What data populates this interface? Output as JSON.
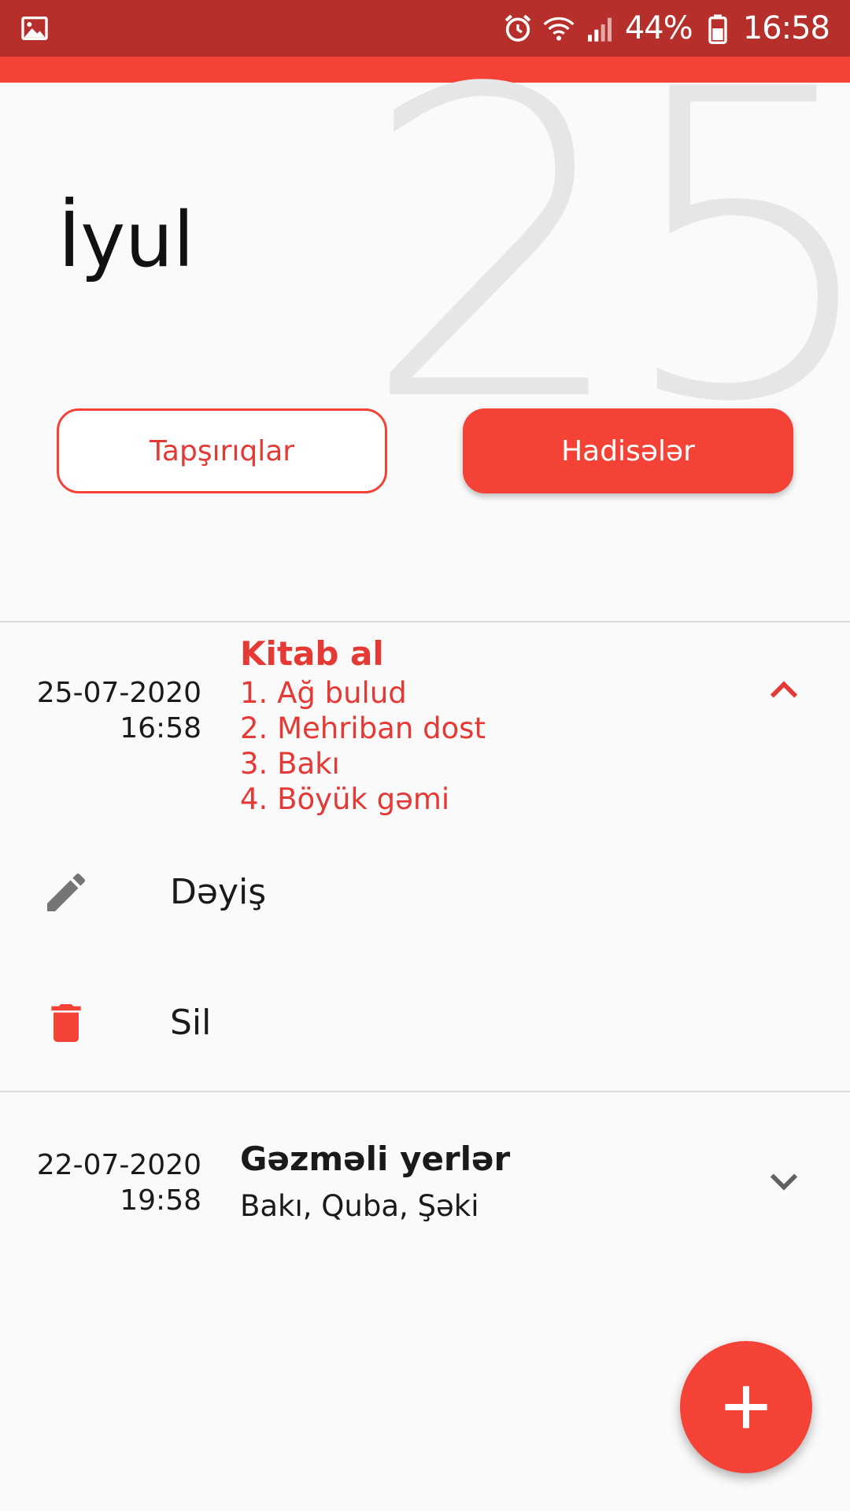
{
  "status_bar": {
    "battery": "44%",
    "time": "16:58"
  },
  "header": {
    "day": "25",
    "month": "İyul"
  },
  "tabs": {
    "tasks_label": "Tapşırıqlar",
    "events_label": "Hadisələr"
  },
  "events": [
    {
      "date": "25-07-2020",
      "time": "16:58",
      "title": "Kitab al",
      "lines": [
        "1. Ağ bulud",
        "2. Mehriban dost",
        "3. Bakı",
        "4. Böyük gəmi"
      ],
      "expanded": true
    },
    {
      "date": "22-07-2020",
      "time": "19:58",
      "title": "Gəzməli yerlər",
      "lines": [
        "Bakı, Quba, Şəki"
      ],
      "expanded": false
    }
  ],
  "actions": {
    "edit_label": "Dəyiş",
    "delete_label": "Sil"
  },
  "colors": {
    "accent": "#f44336",
    "status_bar": "#b72f2a",
    "edit_icon": "#757575"
  },
  "icons": {
    "gallery": "gallery-icon",
    "alarm": "alarm-icon",
    "wifi": "wifi-icon",
    "signal": "signal-icon",
    "battery": "battery-icon",
    "expand_less": "chevron-up-icon",
    "expand_more": "chevron-down-icon",
    "edit": "pencil-icon",
    "delete": "trash-icon",
    "add": "plus-icon"
  }
}
